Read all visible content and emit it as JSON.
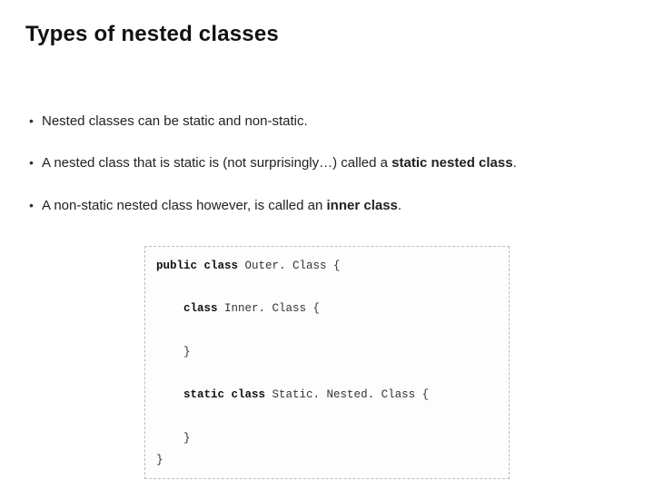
{
  "title": "Types of nested classes",
  "bullets": [
    {
      "pre": "Nested classes can be static and non-static.",
      "bold": "",
      "post": ""
    },
    {
      "pre": "A nested class that is static is (not surprisingly…) called a ",
      "bold": "static nested class",
      "post": "."
    },
    {
      "pre": "A non-static nested class however, is called an ",
      "bold": "inner class",
      "post": "."
    }
  ],
  "code": {
    "l1_kw": "public class ",
    "l1_rest": "Outer. Class {",
    "l2_kw": "class ",
    "l2_rest": "Inner. Class {",
    "l3": "}",
    "l4_kw": "static class ",
    "l4_rest": "Static. Nested. Class {",
    "l5": "}",
    "l6": "}"
  }
}
